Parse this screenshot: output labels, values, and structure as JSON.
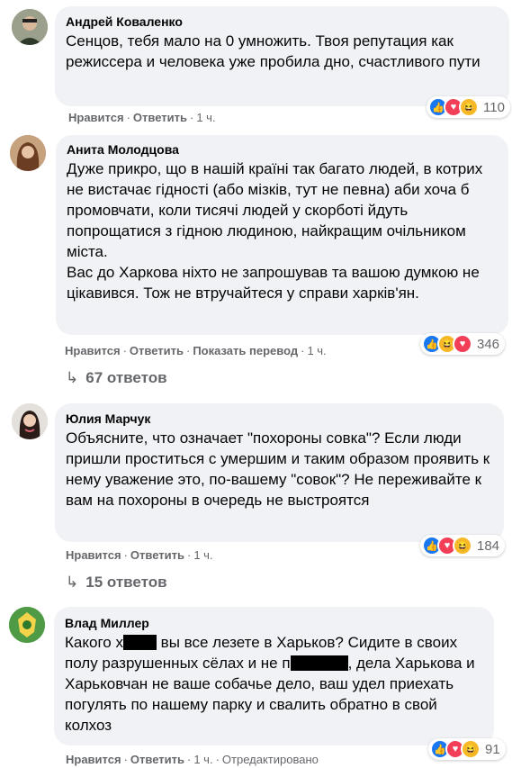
{
  "comments": [
    {
      "author": "Андрей Коваленко",
      "text": [
        "Сенцов, тебя мало на 0 умножить. Твоя репутация как режиссера и человека уже пробила дно, счастливого пути"
      ],
      "actions": {
        "like": "Нравится",
        "reply": "Ответить",
        "time": "1 ч."
      },
      "reactions": {
        "icons": [
          "like-icon",
          "love-icon",
          "haha-icon"
        ],
        "count": "110"
      }
    },
    {
      "author": "Анита Молодцова",
      "text": [
        "Дуже прикро, що в нашій країні так багато людей, в котрих не вистачає гідності (або мізків, тут не певна) аби хоча б промовчати, коли тисячі людей у скорботі йдуть попрощатися з гідною людиною, найкращим очільником міста.",
        "Вас до Харкова ніхто не запрошував та вашою думкою не цікавився. Тож не втручайтеся у справи харків'ян."
      ],
      "actions": {
        "like": "Нравится",
        "reply": "Ответить",
        "translate": "Показать перевод",
        "time": "1 ч."
      },
      "reactions": {
        "icons": [
          "like-icon",
          "haha-icon",
          "love-icon"
        ],
        "count": "346"
      },
      "replies": "67 ответов"
    },
    {
      "author": "Юлия Марчук",
      "text": [
        "Объясните, что означает \"похороны совка\"? Если люди пришли проститься с умершим и таким образом проявить к нему уважение это, по-вашему \"совок\"? Не переживайте к вам на похороны в очередь не выстроятся"
      ],
      "actions": {
        "like": "Нравится",
        "reply": "Ответить",
        "time": "1 ч."
      },
      "reactions": {
        "icons": [
          "like-icon",
          "love-icon",
          "haha-icon"
        ],
        "count": "184"
      },
      "replies": "15 ответов"
    },
    {
      "author": "Влад Миллер",
      "text_parts": {
        "p1": "Какого х",
        "p2": " вы все лезете в Харьков? Сидите в своих полу разрушенных сёлах и не п",
        "p3": ", дела Харькова и Харьковчан не ваше собачье дело, ваш удел приехать погулять по нашему парку и свалить обратно в свой колхоз"
      },
      "actions": {
        "like": "Нравится",
        "reply": "Ответить",
        "time": "1 ч.",
        "edited": "Отредактировано"
      },
      "reactions": {
        "icons": [
          "like-icon",
          "love-icon",
          "haha-icon"
        ],
        "count": "91"
      }
    }
  ],
  "colors": {
    "bubble": "#f0f2f5",
    "meta": "#65676b",
    "like": "#1877f2",
    "love": "#f33e58",
    "haha": "#f7b928"
  }
}
